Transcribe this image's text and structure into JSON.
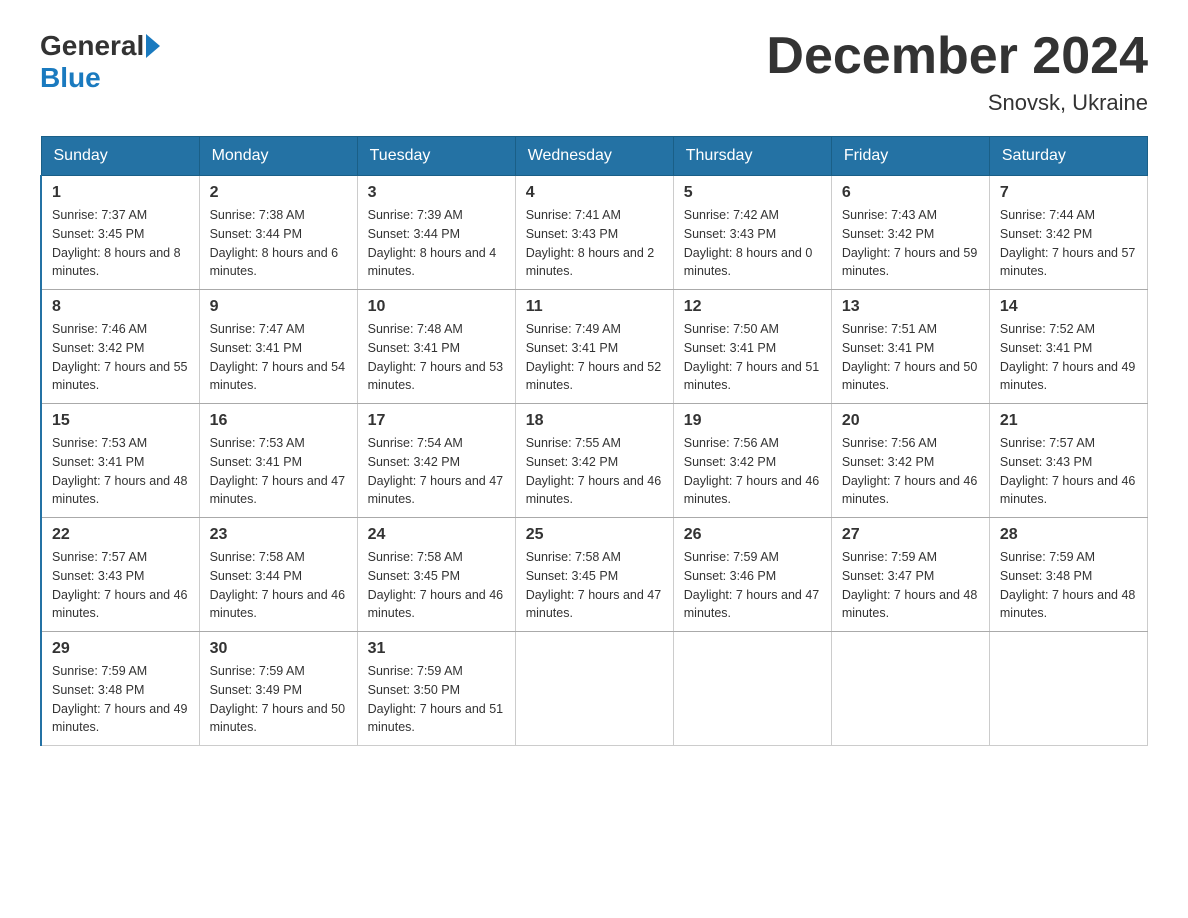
{
  "logo": {
    "general": "General",
    "blue": "Blue"
  },
  "title": "December 2024",
  "location": "Snovsk, Ukraine",
  "days_of_week": [
    "Sunday",
    "Monday",
    "Tuesday",
    "Wednesday",
    "Thursday",
    "Friday",
    "Saturday"
  ],
  "weeks": [
    [
      {
        "day": "1",
        "sunrise": "7:37 AM",
        "sunset": "3:45 PM",
        "daylight": "8 hours and 8 minutes."
      },
      {
        "day": "2",
        "sunrise": "7:38 AM",
        "sunset": "3:44 PM",
        "daylight": "8 hours and 6 minutes."
      },
      {
        "day": "3",
        "sunrise": "7:39 AM",
        "sunset": "3:44 PM",
        "daylight": "8 hours and 4 minutes."
      },
      {
        "day": "4",
        "sunrise": "7:41 AM",
        "sunset": "3:43 PM",
        "daylight": "8 hours and 2 minutes."
      },
      {
        "day": "5",
        "sunrise": "7:42 AM",
        "sunset": "3:43 PM",
        "daylight": "8 hours and 0 minutes."
      },
      {
        "day": "6",
        "sunrise": "7:43 AM",
        "sunset": "3:42 PM",
        "daylight": "7 hours and 59 minutes."
      },
      {
        "day": "7",
        "sunrise": "7:44 AM",
        "sunset": "3:42 PM",
        "daylight": "7 hours and 57 minutes."
      }
    ],
    [
      {
        "day": "8",
        "sunrise": "7:46 AM",
        "sunset": "3:42 PM",
        "daylight": "7 hours and 55 minutes."
      },
      {
        "day": "9",
        "sunrise": "7:47 AM",
        "sunset": "3:41 PM",
        "daylight": "7 hours and 54 minutes."
      },
      {
        "day": "10",
        "sunrise": "7:48 AM",
        "sunset": "3:41 PM",
        "daylight": "7 hours and 53 minutes."
      },
      {
        "day": "11",
        "sunrise": "7:49 AM",
        "sunset": "3:41 PM",
        "daylight": "7 hours and 52 minutes."
      },
      {
        "day": "12",
        "sunrise": "7:50 AM",
        "sunset": "3:41 PM",
        "daylight": "7 hours and 51 minutes."
      },
      {
        "day": "13",
        "sunrise": "7:51 AM",
        "sunset": "3:41 PM",
        "daylight": "7 hours and 50 minutes."
      },
      {
        "day": "14",
        "sunrise": "7:52 AM",
        "sunset": "3:41 PM",
        "daylight": "7 hours and 49 minutes."
      }
    ],
    [
      {
        "day": "15",
        "sunrise": "7:53 AM",
        "sunset": "3:41 PM",
        "daylight": "7 hours and 48 minutes."
      },
      {
        "day": "16",
        "sunrise": "7:53 AM",
        "sunset": "3:41 PM",
        "daylight": "7 hours and 47 minutes."
      },
      {
        "day": "17",
        "sunrise": "7:54 AM",
        "sunset": "3:42 PM",
        "daylight": "7 hours and 47 minutes."
      },
      {
        "day": "18",
        "sunrise": "7:55 AM",
        "sunset": "3:42 PM",
        "daylight": "7 hours and 46 minutes."
      },
      {
        "day": "19",
        "sunrise": "7:56 AM",
        "sunset": "3:42 PM",
        "daylight": "7 hours and 46 minutes."
      },
      {
        "day": "20",
        "sunrise": "7:56 AM",
        "sunset": "3:42 PM",
        "daylight": "7 hours and 46 minutes."
      },
      {
        "day": "21",
        "sunrise": "7:57 AM",
        "sunset": "3:43 PM",
        "daylight": "7 hours and 46 minutes."
      }
    ],
    [
      {
        "day": "22",
        "sunrise": "7:57 AM",
        "sunset": "3:43 PM",
        "daylight": "7 hours and 46 minutes."
      },
      {
        "day": "23",
        "sunrise": "7:58 AM",
        "sunset": "3:44 PM",
        "daylight": "7 hours and 46 minutes."
      },
      {
        "day": "24",
        "sunrise": "7:58 AM",
        "sunset": "3:45 PM",
        "daylight": "7 hours and 46 minutes."
      },
      {
        "day": "25",
        "sunrise": "7:58 AM",
        "sunset": "3:45 PM",
        "daylight": "7 hours and 47 minutes."
      },
      {
        "day": "26",
        "sunrise": "7:59 AM",
        "sunset": "3:46 PM",
        "daylight": "7 hours and 47 minutes."
      },
      {
        "day": "27",
        "sunrise": "7:59 AM",
        "sunset": "3:47 PM",
        "daylight": "7 hours and 48 minutes."
      },
      {
        "day": "28",
        "sunrise": "7:59 AM",
        "sunset": "3:48 PM",
        "daylight": "7 hours and 48 minutes."
      }
    ],
    [
      {
        "day": "29",
        "sunrise": "7:59 AM",
        "sunset": "3:48 PM",
        "daylight": "7 hours and 49 minutes."
      },
      {
        "day": "30",
        "sunrise": "7:59 AM",
        "sunset": "3:49 PM",
        "daylight": "7 hours and 50 minutes."
      },
      {
        "day": "31",
        "sunrise": "7:59 AM",
        "sunset": "3:50 PM",
        "daylight": "7 hours and 51 minutes."
      },
      null,
      null,
      null,
      null
    ]
  ],
  "labels": {
    "sunrise": "Sunrise:",
    "sunset": "Sunset:",
    "daylight": "Daylight:"
  }
}
